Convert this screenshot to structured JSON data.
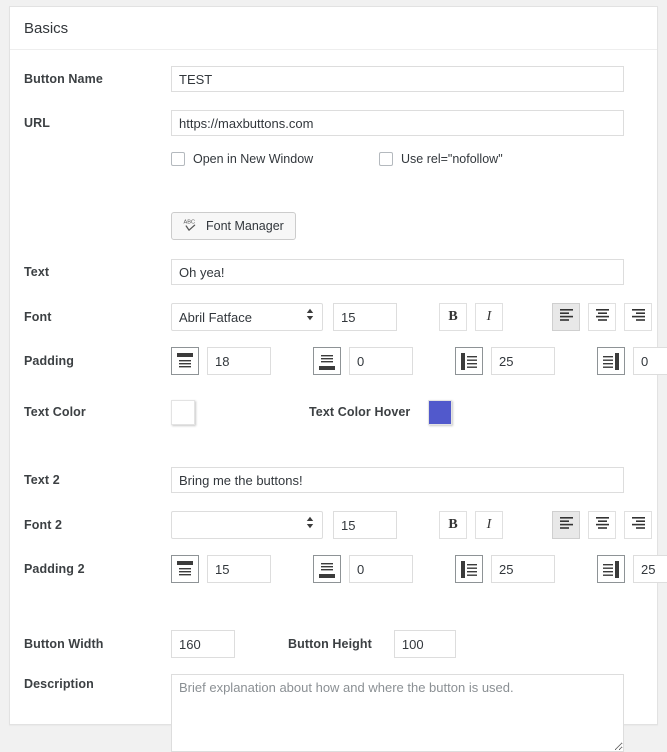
{
  "panel": {
    "title": "Basics"
  },
  "fields": {
    "button_name": {
      "label": "Button Name",
      "value": "TEST",
      "placeholder": ""
    },
    "url": {
      "label": "URL",
      "value": "https://maxbuttons.com",
      "placeholder": ""
    },
    "open_new_window": {
      "label": "Open in New Window",
      "checked": false
    },
    "nofollow": {
      "label": "Use rel=\"nofollow\"",
      "checked": false
    },
    "font_manager_button": {
      "label": "Font Manager",
      "icon": "abc-spellcheck-icon"
    },
    "text": {
      "label": "Text",
      "value": "Oh yea!",
      "placeholder": ""
    },
    "font": {
      "label": "Font",
      "selected": "Abril Fatface",
      "options": [
        "Abril Fatface"
      ],
      "size": "15",
      "bold_label": "B",
      "italic_label": "I",
      "align": "left",
      "align_options": [
        "left",
        "center",
        "right"
      ]
    },
    "padding": {
      "label": "Padding",
      "top": "18",
      "bottom": "0",
      "left": "25",
      "right": "0"
    },
    "text_color": {
      "label": "Text Color",
      "value": "#ffffff"
    },
    "text_color_hover": {
      "label": "Text Color Hover",
      "value": "#5159cc"
    },
    "text2": {
      "label": "Text 2",
      "value": "Bring me the buttons!",
      "placeholder": ""
    },
    "font2": {
      "label": "Font 2",
      "selected": "",
      "options": [
        ""
      ],
      "size": "15",
      "bold_label": "B",
      "italic_label": "I",
      "align": "left",
      "align_options": [
        "left",
        "center",
        "right"
      ]
    },
    "padding2": {
      "label": "Padding 2",
      "top": "15",
      "bottom": "0",
      "left": "25",
      "right": "25"
    },
    "button_width": {
      "label": "Button Width",
      "value": "160"
    },
    "button_height": {
      "label": "Button Height",
      "value": "100"
    },
    "description": {
      "label": "Description",
      "value": "",
      "placeholder": "Brief explanation about how and where the button is used."
    }
  },
  "colors": {
    "panel_bg": "#ffffff",
    "page_bg": "#f1f1f1",
    "border": "#e2e2e2",
    "text": "#32373c",
    "hover_swatch": "#5159cc"
  }
}
